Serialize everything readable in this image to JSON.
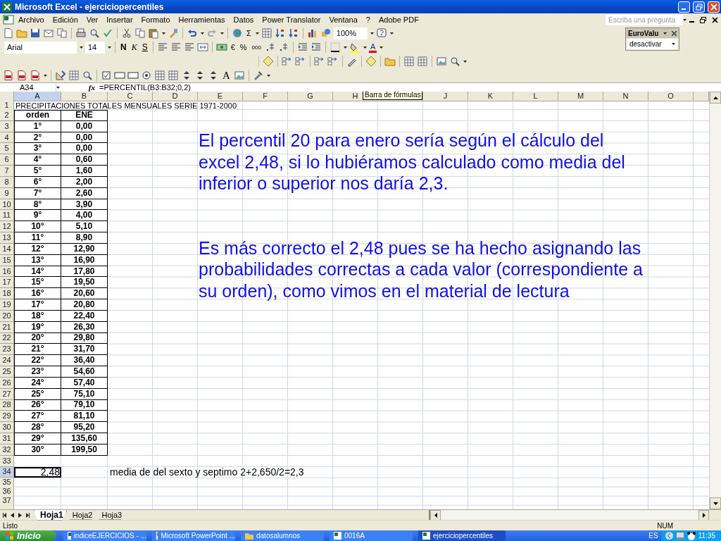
{
  "window": {
    "title": "Microsoft Excel - ejerciciopercentiles"
  },
  "menu": {
    "items": [
      "Archivo",
      "Edición",
      "Ver",
      "Insertar",
      "Formato",
      "Herramientas",
      "Datos",
      "Power Translator",
      "Ventana",
      "?",
      "Adobe PDF"
    ],
    "question_placeholder": "Escriba una pregunta"
  },
  "standard_toolbar": {
    "sigma": "Σ",
    "zoom": "100%"
  },
  "format_toolbar": {
    "font": "Arial",
    "size": "14",
    "bold": "N",
    "italic": "K",
    "underline": "S",
    "euro": "€",
    "percent": "%",
    "thousands": "000",
    "font_color": "A"
  },
  "forms_toolbar": {
    "label": "A"
  },
  "eurovalue": {
    "title": "EuroValu",
    "value": "desactivar"
  },
  "formula_bar": {
    "cell": "A34",
    "fx": "fx",
    "formula": "=PERCENTIL(B3:B32;0,2)"
  },
  "tooltip": "Barra de fórmulas",
  "columns": [
    {
      "label": "A",
      "selected": true
    },
    {
      "label": "B",
      "selected": false
    },
    {
      "label": "C",
      "selected": false
    },
    {
      "label": "D",
      "selected": false
    },
    {
      "label": "E",
      "selected": false
    },
    {
      "label": "F",
      "selected": false
    },
    {
      "label": "G",
      "selected": false
    },
    {
      "label": "H",
      "selected": false
    },
    {
      "selected": false
    },
    {
      "label": "J",
      "selected": false
    },
    {
      "label": "K",
      "selected": false
    },
    {
      "label": "L",
      "selected": false
    },
    {
      "label": "M",
      "selected": false
    },
    {
      "label": "N",
      "selected": false
    },
    {
      "label": "O",
      "selected": false
    }
  ],
  "rows": [
    {
      "number": "1",
      "selected": false,
      "kind": "title",
      "cells": {
        "A": "PRECIPITACIONES TOTALES MENSUALES SERIE 1971-2000"
      }
    },
    {
      "number": "2",
      "selected": false,
      "kind": "header",
      "cells": {
        "A": "orden",
        "B": "ENE"
      }
    },
    {
      "number": "3",
      "selected": false,
      "kind": "data",
      "cells": {
        "A": "1°",
        "B": "0,00"
      }
    },
    {
      "number": "4",
      "selected": false,
      "kind": "data",
      "cells": {
        "A": "2°",
        "B": "0,00"
      }
    },
    {
      "number": "5",
      "selected": false,
      "kind": "data",
      "cells": {
        "A": "3°",
        "B": "0,00"
      }
    },
    {
      "number": "6",
      "selected": false,
      "kind": "data",
      "cells": {
        "A": "4°",
        "B": "0,60"
      }
    },
    {
      "number": "7",
      "selected": false,
      "kind": "data",
      "cells": {
        "A": "5°",
        "B": "1,60"
      }
    },
    {
      "number": "8",
      "selected": false,
      "kind": "data",
      "cells": {
        "A": "6°",
        "B": "2,00"
      }
    },
    {
      "number": "9",
      "selected": false,
      "kind": "data",
      "cells": {
        "A": "7°",
        "B": "2,60"
      }
    },
    {
      "number": "10",
      "selected": false,
      "kind": "data",
      "cells": {
        "A": "8°",
        "B": "3,90"
      }
    },
    {
      "number": "11",
      "selected": false,
      "kind": "data",
      "cells": {
        "A": "9°",
        "B": "4,00"
      }
    },
    {
      "number": "12",
      "selected": false,
      "kind": "data",
      "cells": {
        "A": "10°",
        "B": "5,10"
      }
    },
    {
      "number": "13",
      "selected": false,
      "kind": "data",
      "cells": {
        "A": "11°",
        "B": "8,90"
      }
    },
    {
      "number": "14",
      "selected": false,
      "kind": "data",
      "cells": {
        "A": "12°",
        "B": "12,90"
      }
    },
    {
      "number": "15",
      "selected": false,
      "kind": "data",
      "cells": {
        "A": "13°",
        "B": "16,90"
      }
    },
    {
      "number": "16",
      "selected": false,
      "kind": "data",
      "cells": {
        "A": "14°",
        "B": "17,80"
      }
    },
    {
      "number": "17",
      "selected": false,
      "kind": "data",
      "cells": {
        "A": "15°",
        "B": "19,50"
      }
    },
    {
      "number": "18",
      "selected": false,
      "kind": "data",
      "cells": {
        "A": "16°",
        "B": "20,60"
      }
    },
    {
      "number": "19",
      "selected": false,
      "kind": "data",
      "cells": {
        "A": "17°",
        "B": "20,80"
      }
    },
    {
      "number": "20",
      "selected": false,
      "kind": "data",
      "cells": {
        "A": "18°",
        "B": "22,40"
      }
    },
    {
      "number": "21",
      "selected": false,
      "kind": "data",
      "cells": {
        "A": "19°",
        "B": "26,30"
      }
    },
    {
      "number": "22",
      "selected": false,
      "kind": "data",
      "cells": {
        "A": "20°",
        "B": "29,80"
      }
    },
    {
      "number": "23",
      "selected": false,
      "kind": "data",
      "cells": {
        "A": "21°",
        "B": "31,70"
      }
    },
    {
      "number": "24",
      "selected": false,
      "kind": "data",
      "cells": {
        "A": "22°",
        "B": "36,40"
      }
    },
    {
      "number": "25",
      "selected": false,
      "kind": "data",
      "cells": {
        "A": "23°",
        "B": "54,60"
      }
    },
    {
      "number": "26",
      "selected": false,
      "kind": "data",
      "cells": {
        "A": "24°",
        "B": "57,40"
      }
    },
    {
      "number": "27",
      "selected": false,
      "kind": "data",
      "cells": {
        "A": "25°",
        "B": "75,10"
      }
    },
    {
      "number": "28",
      "selected": false,
      "kind": "data",
      "cells": {
        "A": "26°",
        "B": "79,10"
      }
    },
    {
      "number": "29",
      "selected": false,
      "kind": "data",
      "cells": {
        "A": "27°",
        "B": "81,10"
      }
    },
    {
      "number": "30",
      "selected": false,
      "kind": "data",
      "cells": {
        "A": "28°",
        "B": "95,20"
      }
    },
    {
      "number": "31",
      "selected": false,
      "kind": "data",
      "cells": {
        "A": "29°",
        "B": "135,60"
      }
    },
    {
      "number": "32",
      "selected": false,
      "kind": "data",
      "cells": {
        "A": "30°",
        "B": "199,50"
      }
    },
    {
      "number": "33",
      "selected": false,
      "kind": "gap"
    },
    {
      "number": "34",
      "selected": true,
      "kind": "result",
      "cell_selected": true,
      "cells": {
        "A": "2,48",
        "C": "media de del sexto y septimo 2+2,650/2=2,3"
      }
    },
    {
      "number": "35",
      "selected": false,
      "kind": "empty"
    },
    {
      "number": "36",
      "selected": false,
      "kind": "empty"
    },
    {
      "number": "37",
      "selected": false,
      "kind": "empty"
    }
  ],
  "note": {
    "paragraphs": [
      "El percentil 20 para enero sería según el cálculo del excel 2,48, si lo hubiéramos calculado como media del inferior o superior nos daría 2,3.",
      "Es más correcto el 2,48 pues se ha hecho asignando las probabilidades correctas a cada valor (correspondiente a su orden), como vimos en el material de lectura"
    ]
  },
  "sheet_tabs": [
    {
      "label": "Hoja1",
      "selected": true
    },
    {
      "label": "Hoja2",
      "selected": false
    },
    {
      "label": "Hoja3",
      "selected": false
    }
  ],
  "status_bar": {
    "text": "Listo",
    "num": "NUM"
  },
  "taskbar": {
    "start": "Inicio",
    "tasks": [
      {
        "label": "indiceEJERCICIOS - ...",
        "kind": "word",
        "selected": false
      },
      {
        "label": "Microsoft PowerPoint ...",
        "kind": "powerpoint",
        "selected": false
      },
      {
        "label": "datosalumnos",
        "kind": "folder",
        "selected": false
      },
      {
        "label": "0016A",
        "kind": "excel",
        "selected": false
      },
      {
        "label": "ejerciciopercentiles",
        "kind": "excel",
        "selected": true
      }
    ],
    "language": "ES",
    "clock": "11:35"
  }
}
